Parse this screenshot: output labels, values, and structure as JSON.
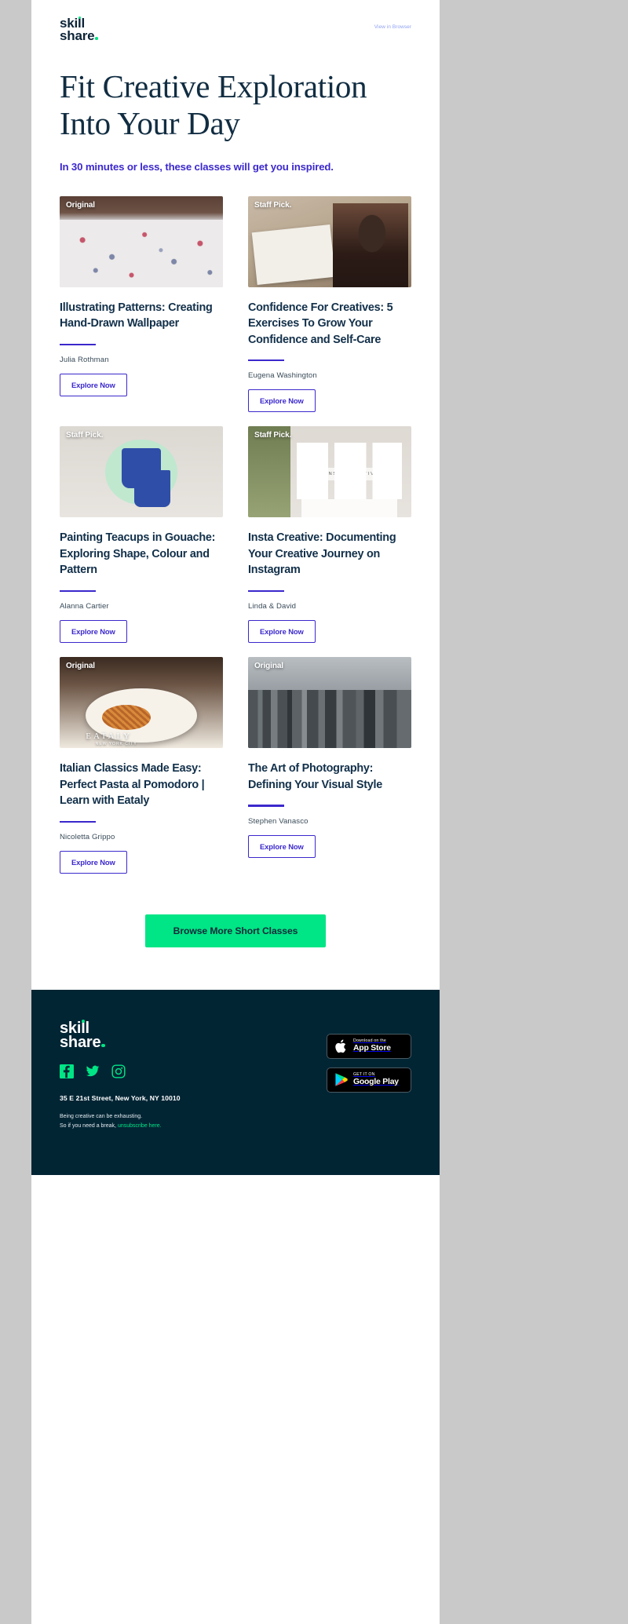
{
  "brand": {
    "logo_line1": "skill",
    "logo_line2": "share",
    "navy": "#022534",
    "purple": "#3b28cc",
    "green": "#00e585"
  },
  "header": {
    "view_in_browser": "View in Browser"
  },
  "hero": {
    "title_line1": "Fit Creative Exploration",
    "title_line2": "Into Your Day",
    "subtitle": "In 30 minutes or less, these classes will get you inspired."
  },
  "cards": [
    {
      "badge": "Original",
      "title": "Illustrating Patterns: Creating Hand-Drawn Wallpaper",
      "author": "Julia Rothman",
      "button": "Explore Now"
    },
    {
      "badge": "Staff Pick.",
      "title": "Confidence For Creatives: 5 Exercises To Grow Your Confidence and Self-Care",
      "author": "Eugena Washington",
      "button": "Explore Now"
    },
    {
      "badge": "Staff Pick.",
      "title": "Painting Teacups in Gouache: Exploring Shape, Colour and Pattern",
      "author": "Alanna Cartier",
      "button": "Explore Now"
    },
    {
      "badge": "Staff Pick.",
      "title": "Insta Creative: Documenting Your Creative Journey on Instagram",
      "author": "Linda & David",
      "button": "Explore Now",
      "overlay_label": "INSTA CREATIVE"
    },
    {
      "badge": "Original",
      "title": "Italian Classics Made Easy: Perfect Pasta al Pomodoro | Learn with Eataly",
      "author": "Nicoletta Grippo",
      "button": "Explore Now",
      "overlay_label": "EATALY",
      "overlay_sublabel": "NEW YORK CITY"
    },
    {
      "badge": "Original",
      "title": "The Art of Photography: Defining Your Visual Style",
      "author": "Stephen Vanasco",
      "button": "Explore Now"
    }
  ],
  "cta": {
    "label": "Browse More Short Classes"
  },
  "footer": {
    "address": "35 E 21st Street, New York, NY 10010",
    "legal_line1": "Being creative can be exhausting.",
    "legal_line2_prefix": "So if you need a break, ",
    "unsubscribe": "unsubscribe here.",
    "social": [
      {
        "name": "facebook-icon"
      },
      {
        "name": "twitter-icon"
      },
      {
        "name": "instagram-icon"
      }
    ],
    "stores": [
      {
        "small": "Download on the",
        "big": "App Store",
        "icon": "apple-icon"
      },
      {
        "small": "GET IT ON",
        "big": "Google Play",
        "icon": "google-play-icon"
      }
    ]
  }
}
